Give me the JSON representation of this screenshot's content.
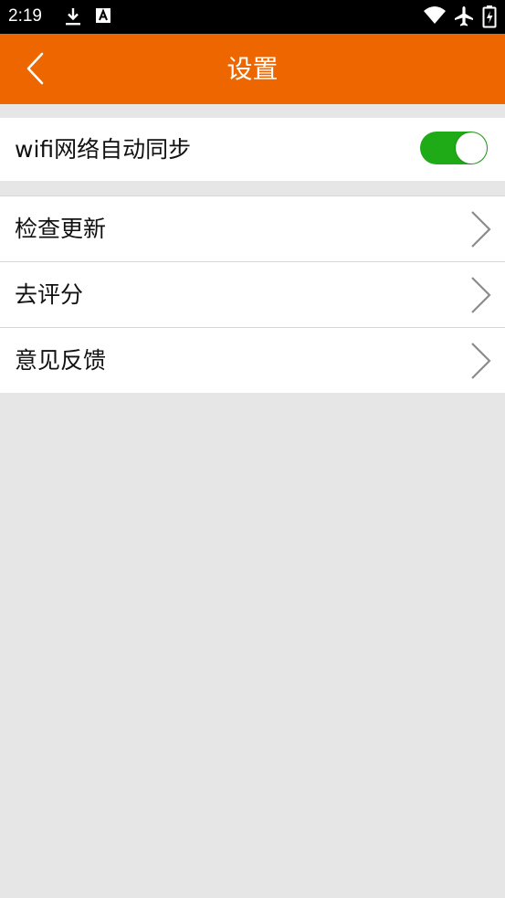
{
  "status_bar": {
    "time": "2:19",
    "left_icons": [
      "download-icon",
      "a-badge-icon"
    ],
    "right_icons": [
      "wifi-icon",
      "airplane-icon",
      "battery-icon"
    ]
  },
  "app_bar": {
    "title": "设置",
    "back_icon": "chevron-left-icon",
    "color": "#ee6600"
  },
  "settings": {
    "wifi_sync": {
      "label": "wifi网络自动同步",
      "enabled": true,
      "toggle_color": "#1fab17"
    },
    "items": [
      {
        "label": "检查更新",
        "icon": "chevron-right-icon"
      },
      {
        "label": "去评分",
        "icon": "chevron-right-icon"
      },
      {
        "label": "意见反馈",
        "icon": "chevron-right-icon"
      }
    ]
  },
  "colors": {
    "background": "#e6e6e6"
  }
}
